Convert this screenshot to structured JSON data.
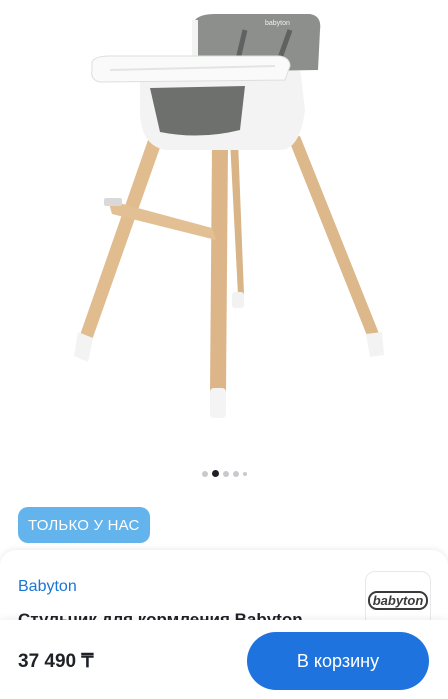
{
  "gallery": {
    "image_alt": "high-chair-photo",
    "chair_brand_print": "babyton",
    "dots_count": 5,
    "active_dot": 1
  },
  "badge": {
    "label": "ТОЛЬКО У НАС"
  },
  "product": {
    "brand": "Babyton",
    "brand_logo": "babyton",
    "title": "Стульчик для кормления Babyton"
  },
  "purchase": {
    "price": "37 490 ₸",
    "cart_button_label": "В корзину"
  },
  "colors": {
    "badge": "#63b3ec",
    "link": "#1976d2",
    "cart_button": "#1f73de"
  }
}
